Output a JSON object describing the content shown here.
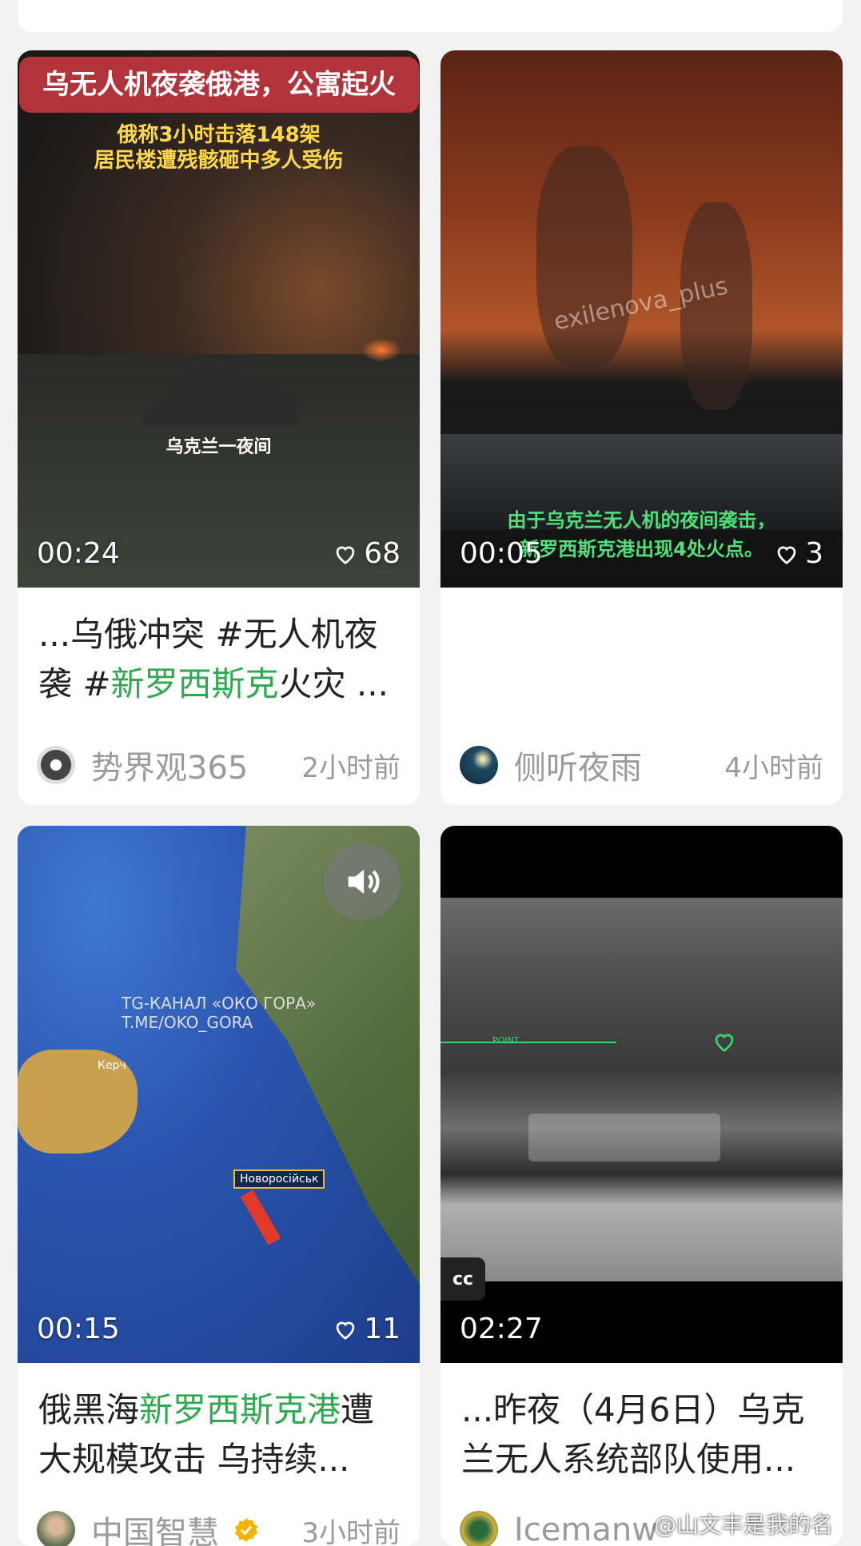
{
  "cards": [
    {
      "overlay_badge": "乌无人机夜袭俄港，公寓起火",
      "overlay_line1": "俄称3小时击落148架",
      "overlay_line2": "居民楼遭残骸砸中多人受伤",
      "overlay_caption": "乌克兰一夜间",
      "duration": "00:24",
      "likes": "68",
      "title_pre": "...乌俄冲突 #无人机夜袭 #",
      "title_hl": "新罗西斯克",
      "title_post": "火灾 ...",
      "author": "势界观365",
      "time": "2小时前"
    },
    {
      "overlay_watermark": "exilenova_plus",
      "overlay_line1": "由于乌克兰无人机的夜间袭击，",
      "overlay_line2": "新罗西斯克港出现4处火点。",
      "duration": "00:05",
      "likes": "3",
      "author": "侧听夜雨",
      "time": "4小时前"
    },
    {
      "overlay_channel1": "TG-КАНАЛ «ОКО ГОРА»",
      "overlay_channel2": "T.ME/OKO_GORA",
      "overlay_city": "Новоросійськ",
      "overlay_kerch": "Керч",
      "duration": "00:15",
      "likes": "11",
      "title_pre": "俄黑海",
      "title_hl": "新罗西斯克港",
      "title_post": "遭大规模攻击 乌持续...",
      "author": "中国智慧",
      "time": "3小时前"
    },
    {
      "cc_label": "cc",
      "overlay_point": "POINT",
      "duration": "02:27",
      "title_pre": "...昨夜（4月6日）乌克兰无人系统部队使用...",
      "author": "Icemanw",
      "watermark": "@山文丰是我的名"
    }
  ],
  "colors": {
    "highlight": "#2fa84f",
    "badge": "#b3333b"
  }
}
